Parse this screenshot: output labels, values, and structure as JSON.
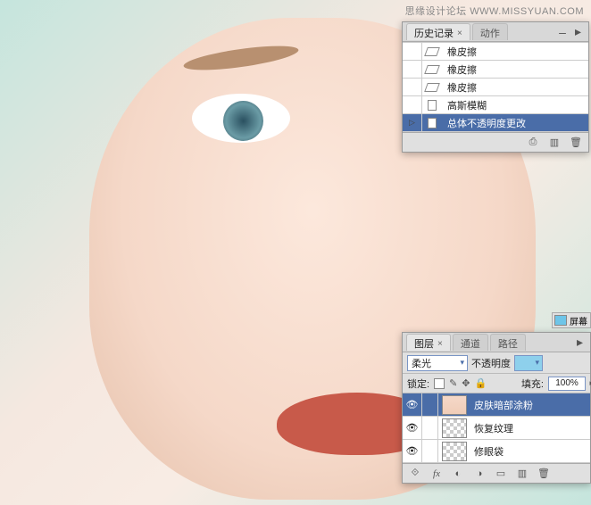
{
  "watermark": "思缘设计论坛  WWW.MISSYUAN.COM",
  "history_panel": {
    "tabs": [
      {
        "label": "历史记录",
        "active": true
      },
      {
        "label": "动作",
        "active": false
      }
    ],
    "items": [
      {
        "label": "橡皮擦",
        "icon": "eraser",
        "selected": false
      },
      {
        "label": "橡皮擦",
        "icon": "eraser",
        "selected": false
      },
      {
        "label": "橡皮擦",
        "icon": "eraser",
        "selected": false
      },
      {
        "label": "高斯模糊",
        "icon": "doc",
        "selected": false
      },
      {
        "label": "总体不透明度更改",
        "icon": "doc",
        "selected": true
      }
    ],
    "footer_icons": [
      "camera",
      "new",
      "delete"
    ]
  },
  "swatch": {
    "label": "屏幕"
  },
  "layers_panel": {
    "tabs": [
      {
        "label": "图层",
        "active": true
      },
      {
        "label": "通道",
        "active": false
      },
      {
        "label": "路径",
        "active": false
      }
    ],
    "blend_mode": "柔光",
    "opacity_label": "不透明度",
    "lock_label": "锁定:",
    "fill_label": "填充:",
    "fill_value": "100%",
    "layers": [
      {
        "name": "皮肤暗部涂粉",
        "thumb": "skin",
        "selected": true,
        "visible": true
      },
      {
        "name": "恢复纹理",
        "thumb": "checker",
        "selected": false,
        "visible": true
      },
      {
        "name": "修眼袋",
        "thumb": "checker",
        "selected": false,
        "visible": true
      }
    ],
    "footer_icons": [
      "link",
      "fx",
      "mask",
      "adjust",
      "group",
      "new",
      "delete"
    ]
  }
}
